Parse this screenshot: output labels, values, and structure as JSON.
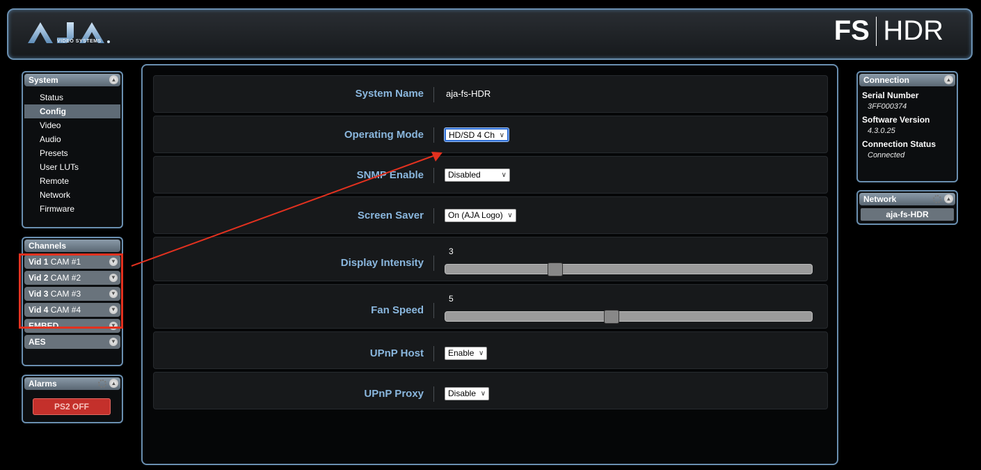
{
  "header": {
    "logo_sub": "VIDEO SYSTEMS",
    "product_fs": "FS",
    "product_hdr": "HDR"
  },
  "system_panel": {
    "title": "System",
    "items": [
      {
        "label": "Status",
        "active": false
      },
      {
        "label": "Config",
        "active": true
      },
      {
        "label": "Video",
        "active": false
      },
      {
        "label": "Audio",
        "active": false
      },
      {
        "label": "Presets",
        "active": false
      },
      {
        "label": "User LUTs",
        "active": false
      },
      {
        "label": "Remote",
        "active": false
      },
      {
        "label": "Network",
        "active": false
      },
      {
        "label": "Firmware",
        "active": false
      }
    ]
  },
  "channels_panel": {
    "title": "Channels",
    "items": [
      {
        "bold": "Vid 1",
        "rest": " CAM #1"
      },
      {
        "bold": "Vid 2",
        "rest": " CAM #2"
      },
      {
        "bold": "Vid 3",
        "rest": " CAM #3"
      },
      {
        "bold": "Vid 4",
        "rest": " CAM #4"
      },
      {
        "bold": "EMBED",
        "rest": ""
      },
      {
        "bold": "AES",
        "rest": ""
      }
    ]
  },
  "alarms_panel": {
    "title": "Alarms",
    "alarm": "PS2 OFF"
  },
  "config": {
    "system_name": {
      "label": "System Name",
      "value": "aja-fs-HDR"
    },
    "operating_mode": {
      "label": "Operating Mode",
      "value": "HD/SD 4 Ch"
    },
    "snmp_enable": {
      "label": "SNMP Enable",
      "value": "Disabled"
    },
    "screen_saver": {
      "label": "Screen Saver",
      "value": "On (AJA Logo)"
    },
    "display_intensity": {
      "label": "Display Intensity",
      "value": "3",
      "level": 0.29
    },
    "fan_speed": {
      "label": "Fan Speed",
      "value": "5",
      "level": 0.45
    },
    "upnp_host": {
      "label": "UPnP Host",
      "value": "Enable"
    },
    "upnp_proxy": {
      "label": "UPnP Proxy",
      "value": "Disable"
    }
  },
  "connection_panel": {
    "title": "Connection",
    "serial_label": "Serial Number",
    "serial_value": "3FF000374",
    "software_label": "Software Version",
    "software_value": "4.3.0.25",
    "status_label": "Connection Status",
    "status_value": "Connected"
  },
  "network_panel": {
    "title": "Network",
    "host": "aja-fs-HDR"
  },
  "colors": {
    "label_blue": "#8ab7de",
    "panel_border": "#6a8fb0",
    "annotation_red": "#e3311f",
    "alarm_red": "#c4302b"
  }
}
